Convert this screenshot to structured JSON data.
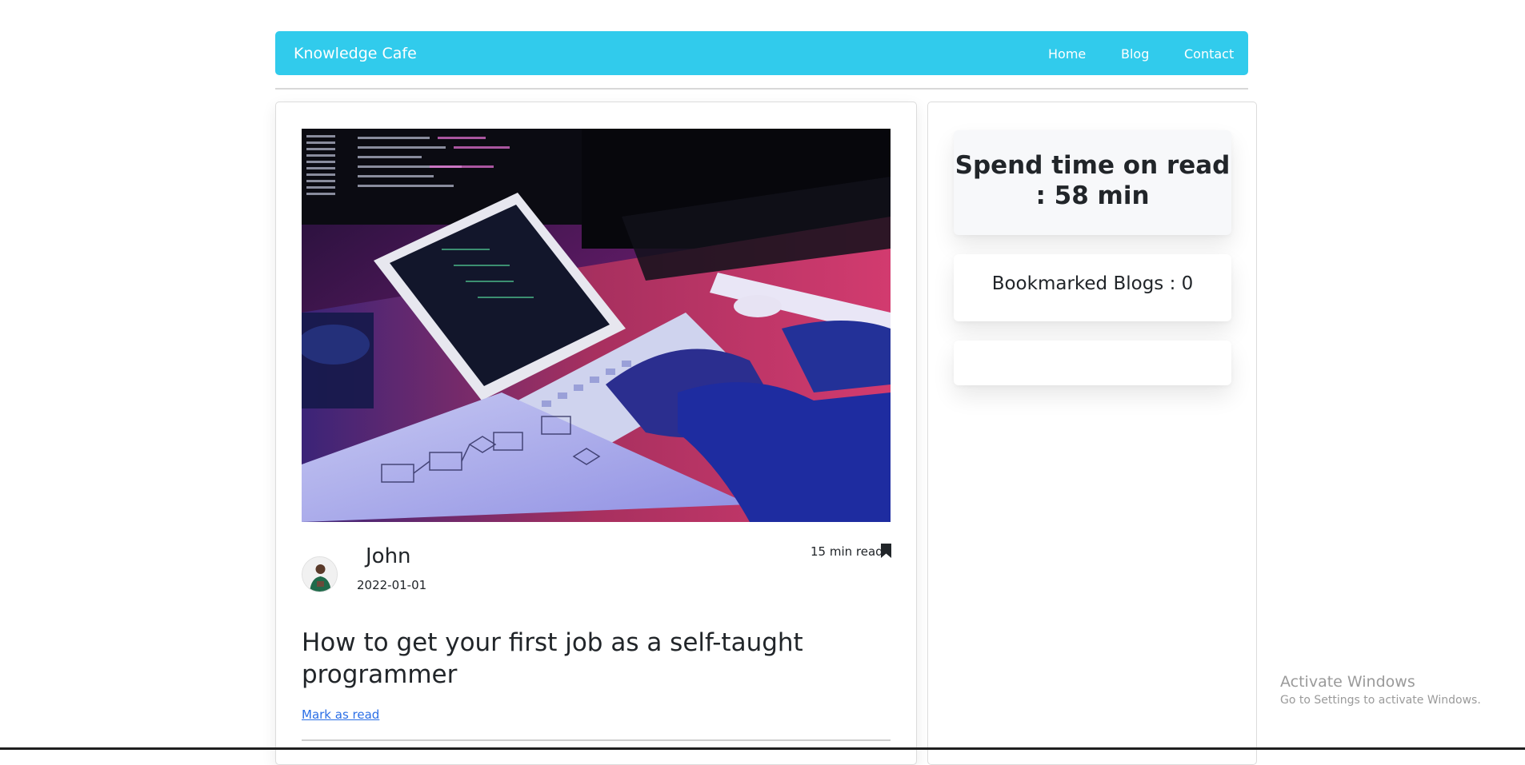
{
  "nav": {
    "brand": "Knowledge Cafe",
    "links": [
      "Home",
      "Blog",
      "Contact"
    ]
  },
  "post": {
    "author": "John",
    "date": "2022-01-01",
    "read_time": "15 min read",
    "title": "How to get your first job as a self-taught programmer",
    "mark_as_read": "Mark as read"
  },
  "sidebar": {
    "spent_time": "Spend time on read : 58 min",
    "bookmarked": "Bookmarked Blogs : 0"
  },
  "watermark": {
    "title": "Activate Windows",
    "subtitle": "Go to Settings to activate Windows."
  },
  "colors": {
    "navbar": "#31cbec",
    "link": "#2a6ee6"
  },
  "icons": [
    "bookmark-icon"
  ]
}
